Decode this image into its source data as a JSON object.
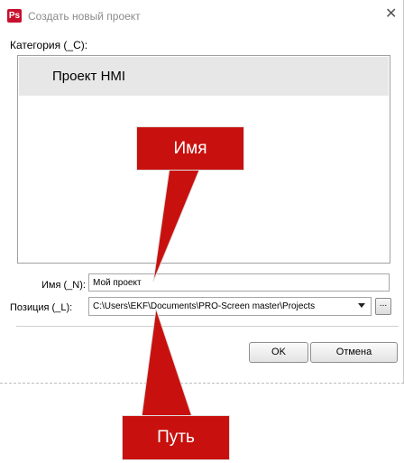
{
  "window": {
    "title": "Создать новый проект",
    "app_icon_text": "Ps",
    "close_icon": "close-icon"
  },
  "category": {
    "label": "Категория (_C):",
    "items": [
      {
        "label": "Проект HMI",
        "selected": true
      }
    ]
  },
  "form": {
    "name_label": "Имя (_N):",
    "name_value": "Мой проект",
    "position_label": "Позиция (_L):",
    "position_value": "C:\\Users\\EKF\\Documents\\PRO-Screen master\\Projects",
    "browse_label": "..."
  },
  "buttons": {
    "ok_label": "OK",
    "cancel_label": "Отмена"
  },
  "annotations": {
    "name_callout": "Имя",
    "path_callout": "Путь",
    "callout_color": "#c8110e"
  },
  "colors": {
    "app_icon": "#c8102e",
    "selection": "#e7e7e7"
  }
}
